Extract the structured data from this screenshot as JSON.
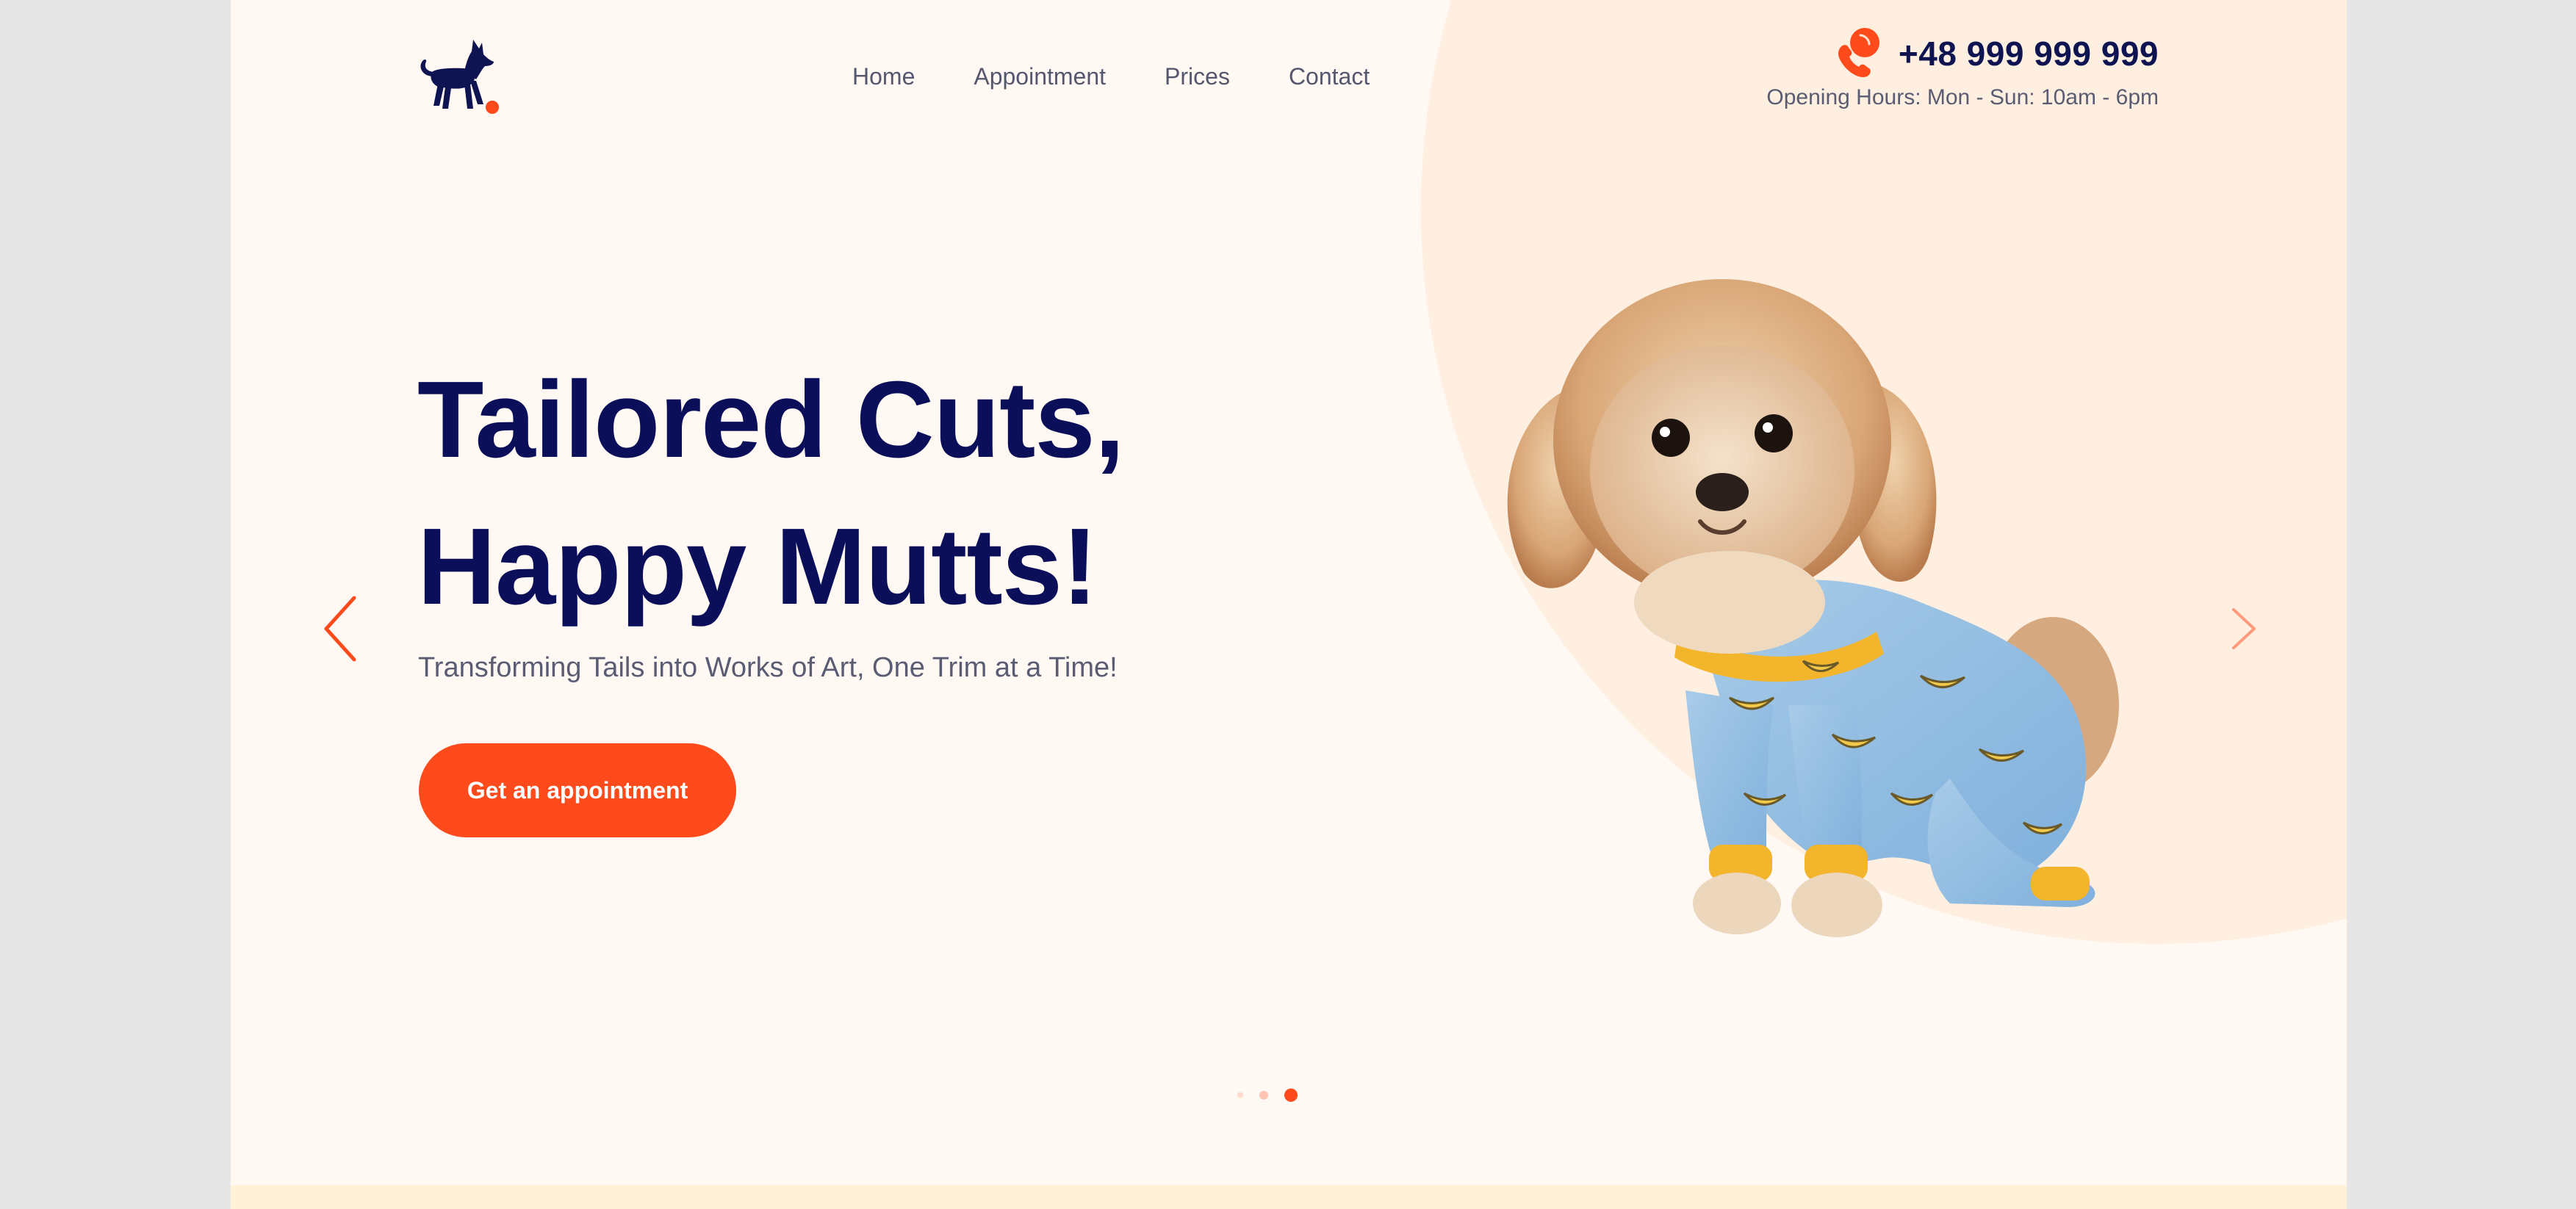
{
  "brand": {
    "logo_icon": "dog-silhouette-icon",
    "accent": "#ff4a1c",
    "navy": "#0b0f5a"
  },
  "nav": {
    "items": [
      {
        "label": "Home"
      },
      {
        "label": "Appointment"
      },
      {
        "label": "Prices"
      },
      {
        "label": "Contact"
      }
    ]
  },
  "contact": {
    "phone_icon": "phone-icon",
    "phone": "+48 999 999 999",
    "hours": "Opening Hours: Mon - Sun: 10am - 6pm"
  },
  "hero": {
    "headline_line1": "Tailored Cuts,",
    "headline_line2": "Happy Mutts!",
    "subtitle": "Transforming Tails into Works of Art, One Trim at a Time!",
    "cta_label": "Get an appointment",
    "image": "dog-in-banana-pajamas",
    "prev_icon": "chevron-left-icon",
    "next_icon": "chevron-right-icon"
  },
  "slider": {
    "total": 3,
    "active": 3
  }
}
